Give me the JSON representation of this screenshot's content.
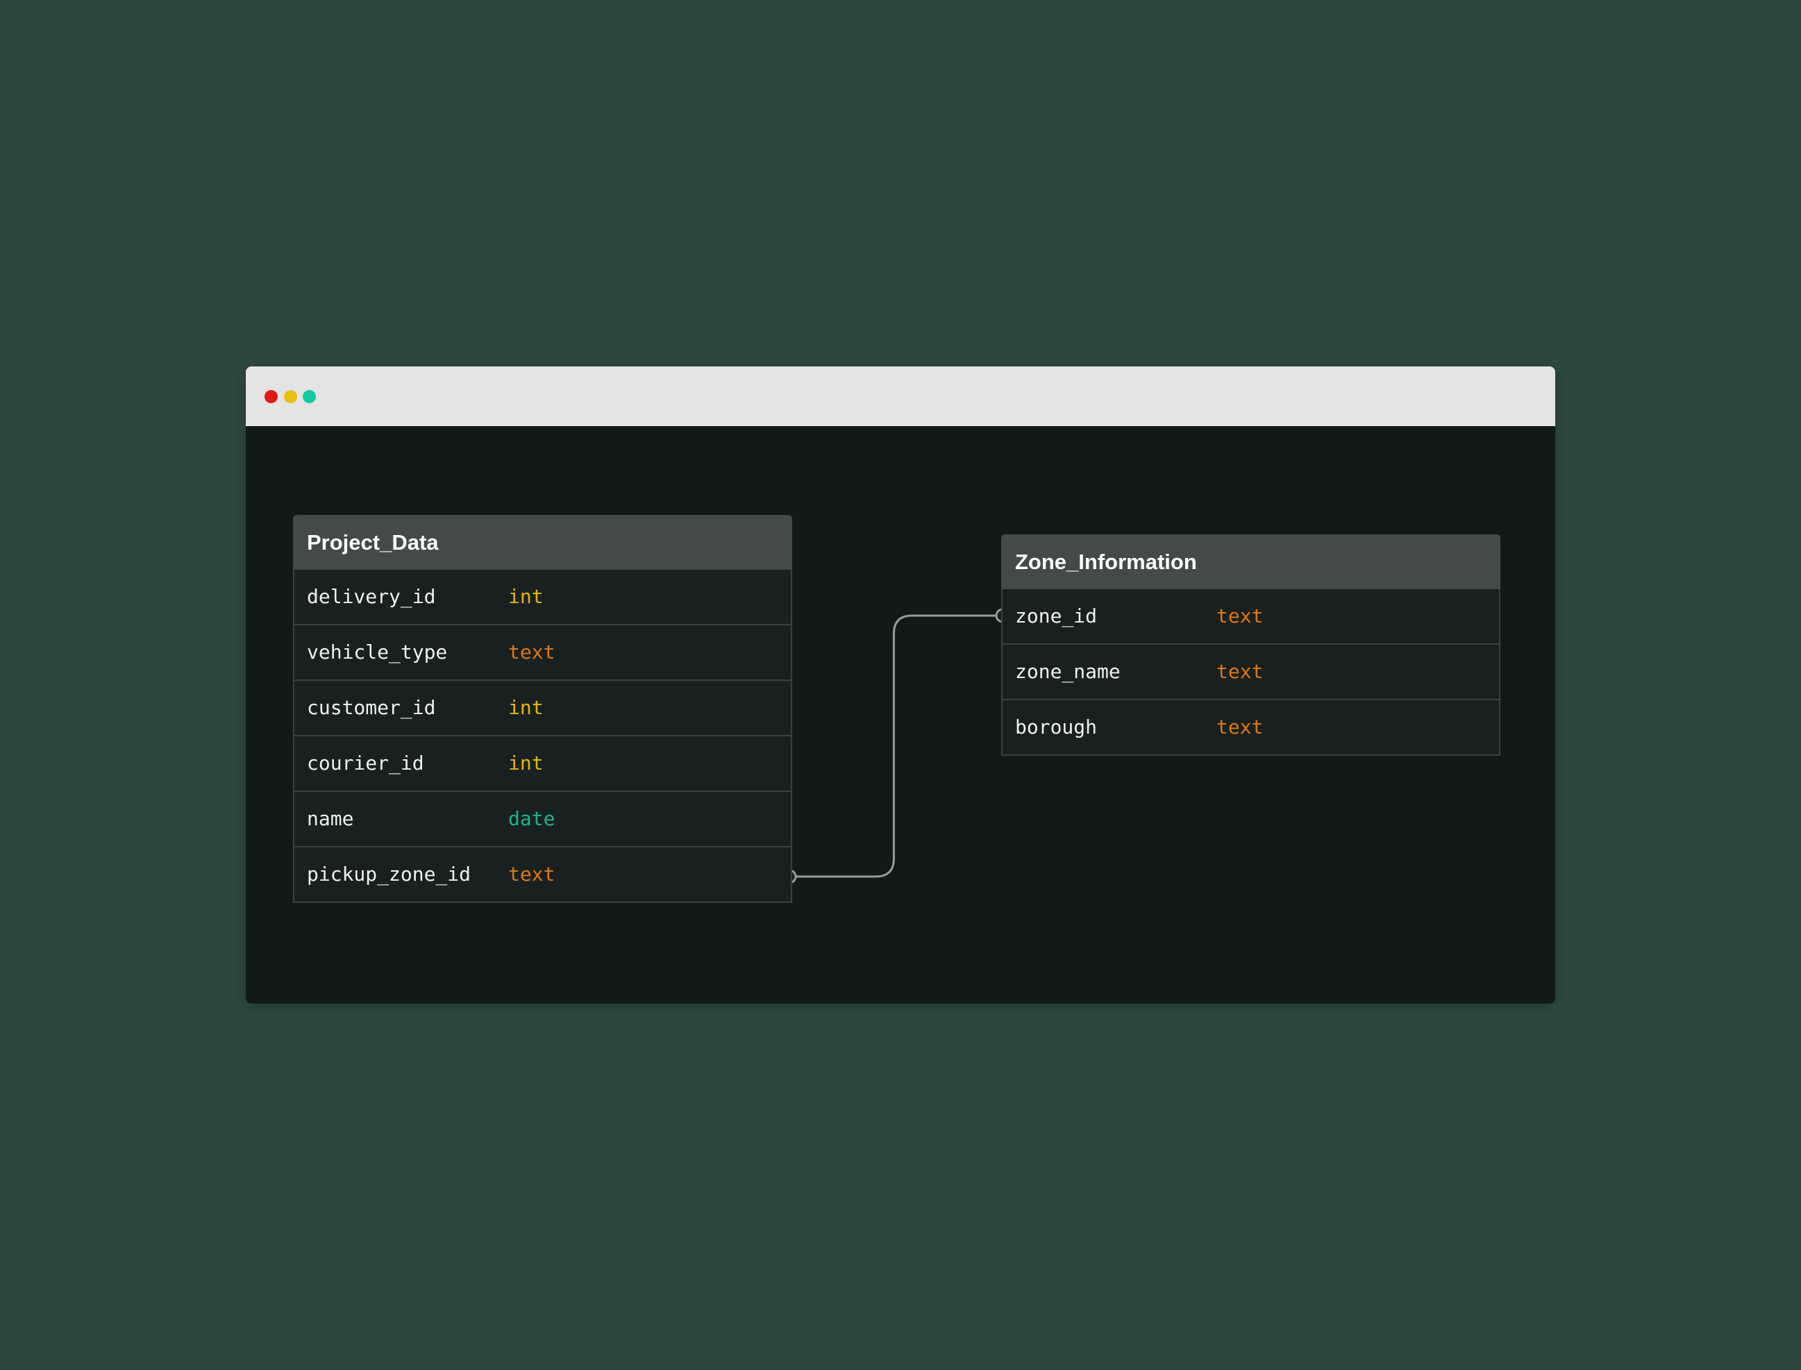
{
  "window": {
    "controls": [
      "close",
      "minimize",
      "maximize"
    ]
  },
  "colors": {
    "background": "#2d4841",
    "canvas": "#121a18",
    "header": "#434a48",
    "int": "#e5b50c",
    "text": "#e07612",
    "date": "#1fb38c",
    "connector": "#9a9a9a"
  },
  "tables": [
    {
      "name": "Project_Data",
      "columns": [
        {
          "name": "delivery_id",
          "type": "int"
        },
        {
          "name": "vehicle_type",
          "type": "text"
        },
        {
          "name": "customer_id",
          "type": "int"
        },
        {
          "name": "courier_id",
          "type": "int"
        },
        {
          "name": "name",
          "type": "date"
        },
        {
          "name": "pickup_zone_id",
          "type": "text"
        }
      ]
    },
    {
      "name": "Zone_Information",
      "columns": [
        {
          "name": "zone_id",
          "type": "text"
        },
        {
          "name": "zone_name",
          "type": "text"
        },
        {
          "name": "borough",
          "type": "text"
        }
      ]
    }
  ],
  "relations": [
    {
      "from": "Project_Data.pickup_zone_id",
      "to": "Zone_Information.zone_id"
    }
  ]
}
